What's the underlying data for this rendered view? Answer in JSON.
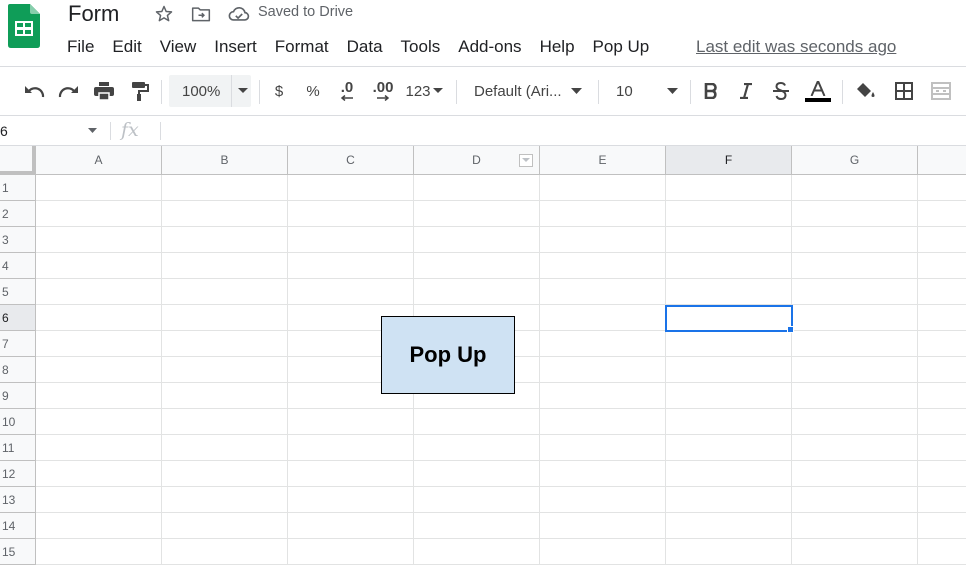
{
  "header": {
    "doc_title": "Form",
    "saved_status": "Saved to Drive",
    "last_edit": "Last edit was seconds ago",
    "menu": [
      "File",
      "Edit",
      "View",
      "Insert",
      "Format",
      "Data",
      "Tools",
      "Add-ons",
      "Help",
      "Pop Up"
    ]
  },
  "toolbar": {
    "zoom": "100%",
    "currency": "$",
    "percent": "%",
    "decrease_decimal": ".0",
    "increase_decimal": ".00",
    "more_formats": "123",
    "font_family": "Default (Ari...",
    "font_size": "10"
  },
  "formula_bar": {
    "name_box": "6",
    "fx": "fx",
    "formula_value": ""
  },
  "sheet": {
    "columns": [
      "A",
      "B",
      "C",
      "D",
      "E",
      "F",
      "G"
    ],
    "rows": [
      "1",
      "2",
      "3",
      "4",
      "5",
      "6",
      "7",
      "8",
      "9",
      "10",
      "11",
      "12",
      "13",
      "14",
      "15"
    ],
    "selected_column": "F",
    "selected_row": "6"
  },
  "drawing": {
    "label": "Pop Up",
    "fill_color": "#cfe2f3"
  },
  "colors": {
    "selection": "#1a73e8",
    "sheets_green": "#0f9d58",
    "text_color_bar": "#000000"
  },
  "icons": {
    "star": "star-icon",
    "move": "move-to-folder-icon",
    "cloud": "cloud-saved-icon"
  }
}
